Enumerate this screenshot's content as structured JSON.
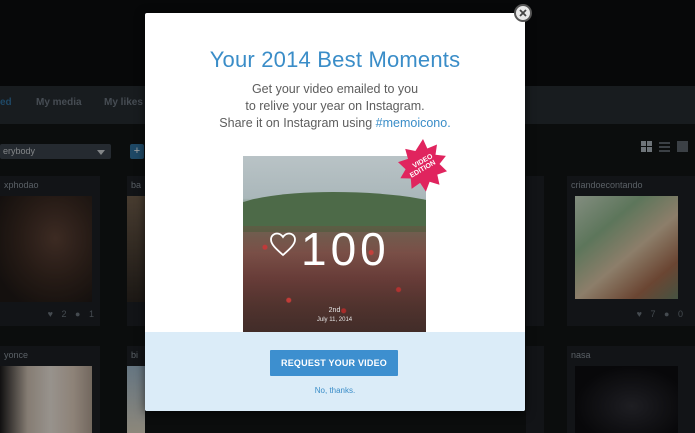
{
  "background": {
    "nav": {
      "tabs": [
        {
          "label": "ed",
          "active": true
        },
        {
          "label": "My media",
          "active": false
        },
        {
          "label": "My likes",
          "active": false
        }
      ]
    },
    "filter": {
      "value": "erybody",
      "add_label": "+"
    },
    "view_icons": [
      "grid-icon",
      "list-icon",
      "single-view-icon"
    ],
    "cards": [
      {
        "user": "xphodao",
        "likes": "2",
        "comments": "1"
      },
      {
        "user": "ba",
        "likes": "",
        "comments": ""
      },
      {
        "user": "",
        "likes": "",
        "comments": ""
      },
      {
        "user": "criandoecontando",
        "likes": "7",
        "comments": "0"
      },
      {
        "user": "yonce",
        "likes": "",
        "comments": ""
      },
      {
        "user": "bi",
        "likes": "",
        "comments": ""
      },
      {
        "user": "",
        "likes": "",
        "comments": ""
      },
      {
        "user": "nasa",
        "likes": "",
        "comments": ""
      }
    ]
  },
  "modal": {
    "title": "Your 2014 Best Moments",
    "line1": "Get your video emailed to you",
    "line2": "to relive your year on Instagram.",
    "line3_prefix": "Share it on Instagram using ",
    "hashtag": "#memoicono.",
    "preview": {
      "count": "100",
      "rank": "2nd",
      "date": "July 11, 2014"
    },
    "badge": {
      "line1": "VIDEO",
      "line2": "EDITION"
    },
    "request_button": "REQUEST YOUR VIDEO",
    "no_thanks": "No, thanks."
  },
  "colors": {
    "accent": "#3a8dc8",
    "button": "#3d8fcf",
    "badge": "#e0245e",
    "footer_bg": "#dbecf8"
  }
}
